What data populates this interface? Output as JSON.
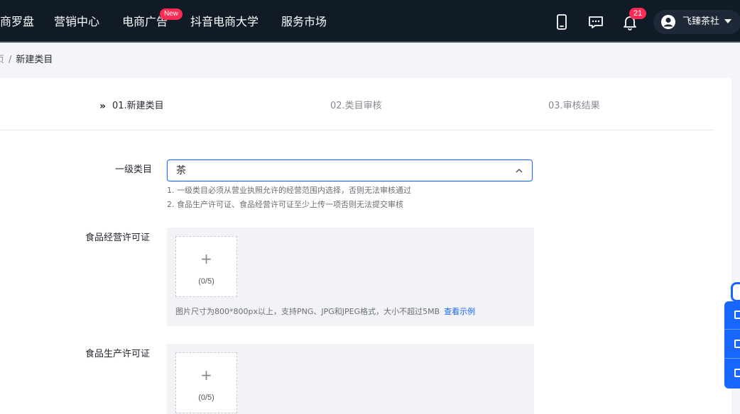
{
  "topnav": {
    "items": [
      {
        "label": "商罗盘"
      },
      {
        "label": "营销中心"
      },
      {
        "label": "电商广告",
        "badge": "New"
      },
      {
        "label": "抖音电商大学"
      },
      {
        "label": "服务市场"
      }
    ],
    "icons": [
      "phone-icon",
      "message-icon",
      "bell-icon"
    ],
    "notification_count": "21",
    "account_name": "飞臻茶社"
  },
  "breadcrumb": {
    "prev": "页",
    "separator": "/",
    "current": "新建类目"
  },
  "steps": [
    {
      "label": "01.新建类目",
      "state": "active"
    },
    {
      "label": "02.类目审核",
      "state": "pending"
    },
    {
      "label": "03.审核结果",
      "state": "pending"
    }
  ],
  "form": {
    "category": {
      "label": "一级类目",
      "value": "茶",
      "hints": [
        "1. 一级类目必须从营业执照允许的经营范围内选择，否则无法审核通过",
        "2. 食品生产许可证、食品经营许可证至少上传一项否则无法提交审核"
      ]
    },
    "food_business_license": {
      "label": "食品经营许可证",
      "plus": "+",
      "count": "(0/5)",
      "hint": "图片尺寸为800*800px以上，支持PNG、JPG和JPEG格式，大小不超过5MB",
      "example_link": "查看示例"
    },
    "food_production_license": {
      "label": "食品生产许可证",
      "plus": "+",
      "count": "(0/5)"
    }
  },
  "colors": {
    "nav_bg": "#111a27",
    "primary": "#1966ff",
    "badge": "#fe2c55"
  }
}
